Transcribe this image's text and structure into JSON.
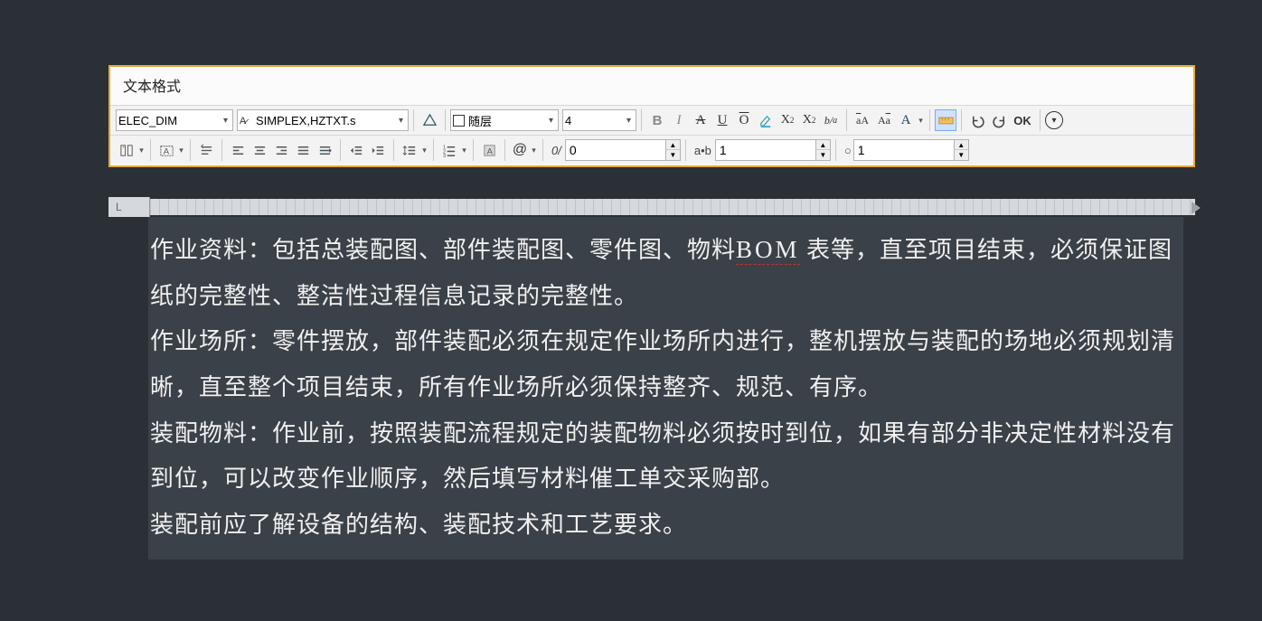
{
  "toolbar": {
    "title": "文本格式",
    "style_dd": "ELEC_DIM",
    "font_dd": "SIMPLEX,HZTXT.s",
    "color_dd": "随层",
    "height_dd": "4",
    "bold": "B",
    "italic": "I",
    "strike": "A",
    "underline": "U",
    "overline": "O",
    "ok": "OK",
    "oblique_label": "0/",
    "track_label": "a•b",
    "width_label": "O",
    "at": "@",
    "oblique_val": "0",
    "track_val": "1",
    "width_val": "1"
  },
  "ruler": {
    "L": "L"
  },
  "text": {
    "p1a": "作业资料：包括总装配图、部件装配图、零件图、物料",
    "p1_bom": "BOM",
    "p1b": " 表等，直至项目结束，必须保证图纸的完整性、整洁性过程信息记录的完整性。",
    "p2": "作业场所：零件摆放，部件装配必须在规定作业场所内进行，整机摆放与装配的场地必须规划清晰，直至整个项目结束，所有作业场所必须保持整齐、规范、有序。",
    "p3": "装配物料：作业前，按照装配流程规定的装配物料必须按时到位，如果有部分非决定性材料没有到位，可以改变作业顺序，然后填写材料催工单交采购部。",
    "p4": "装配前应了解设备的结构、装配技术和工艺要求。"
  }
}
